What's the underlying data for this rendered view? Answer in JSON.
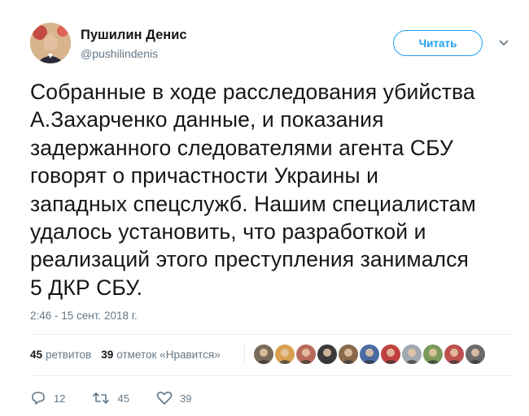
{
  "author": {
    "name": "Пушилин Денис",
    "handle": "@pushilindenis"
  },
  "follow_button": "Читать",
  "tweet_text": "Собранные в ходе расследования  убийства\nА.Захарченко данные, и показания\nзадержанного следователями агента СБУ\nговорят о причастности Украины и\nзападных спецслужб. Нашим специалистам\nудалось установить, что разработкой и\nреализаций этого преступления занимался\n5 ДКР СБУ.",
  "timestamp": "2:46 - 15 сент. 2018 г.",
  "stats": {
    "retweets_count": "45",
    "retweets_label": "ретвитов",
    "likes_count": "39",
    "likes_label": "отметок «Нравится»"
  },
  "likers": [
    {
      "color": "#7a6a5a"
    },
    {
      "color": "#d8a050"
    },
    {
      "color": "#b86a5a"
    },
    {
      "color": "#3a3a3a"
    },
    {
      "color": "#8a6a4a"
    },
    {
      "color": "#4a6aa0"
    },
    {
      "color": "#c04040"
    },
    {
      "color": "#a0a8b0"
    },
    {
      "color": "#7a9a5a"
    },
    {
      "color": "#c05050"
    },
    {
      "color": "#6a6a6a"
    }
  ],
  "actions": {
    "replies": "12",
    "retweets": "45",
    "likes": "39"
  },
  "colors": {
    "accent": "#1da1f2",
    "muted": "#657786",
    "divider": "#e6ecf0"
  }
}
